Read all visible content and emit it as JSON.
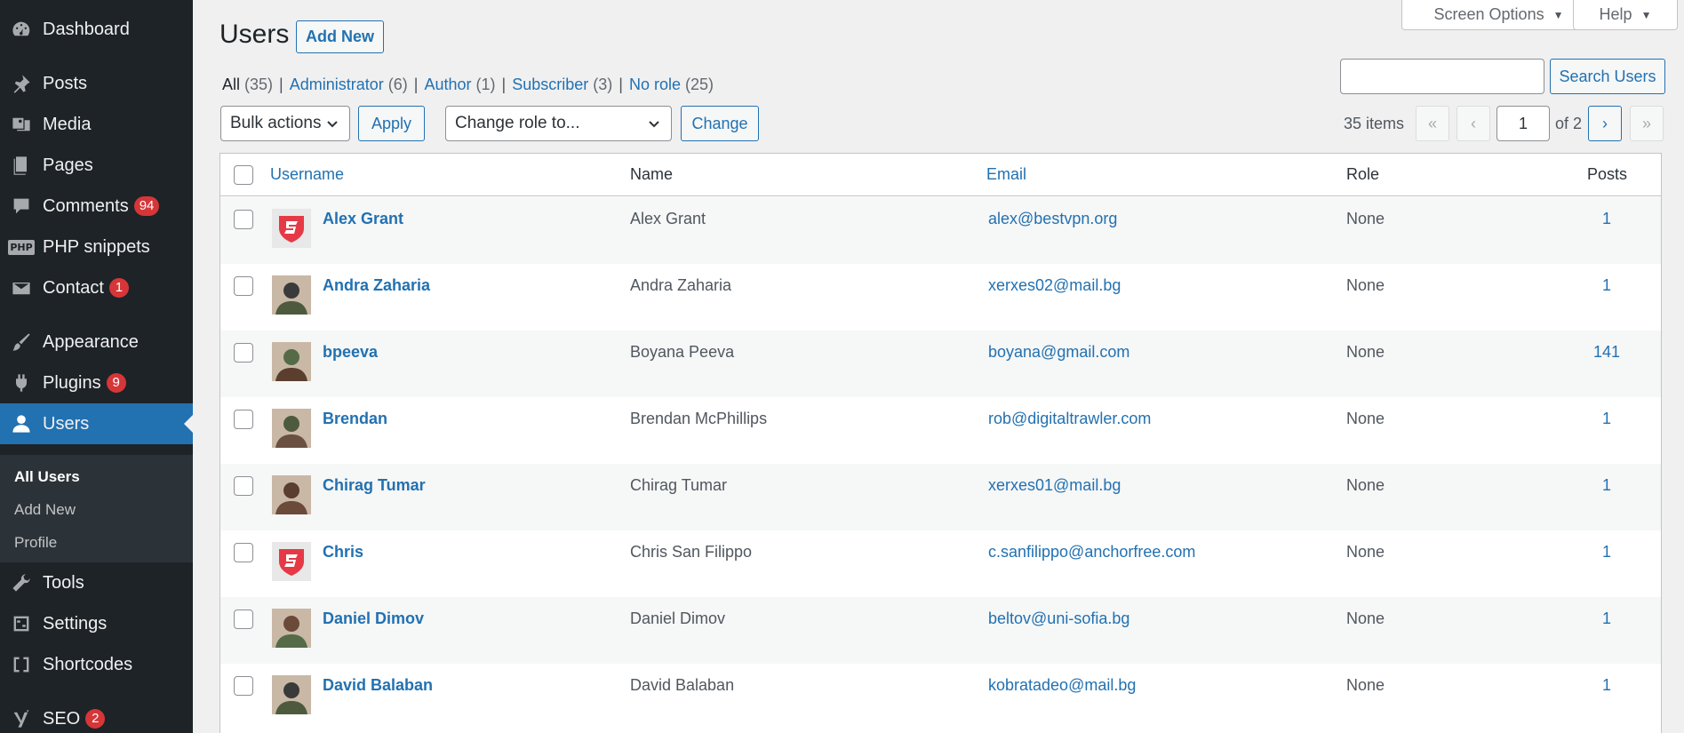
{
  "sidebar": {
    "items": [
      {
        "label": "Dashboard",
        "icon": "dashboard-icon"
      },
      {
        "label": "Posts",
        "icon": "pin-icon"
      },
      {
        "label": "Media",
        "icon": "media-icon"
      },
      {
        "label": "Pages",
        "icon": "pages-icon"
      },
      {
        "label": "Comments",
        "icon": "comment-icon",
        "badge": "94"
      },
      {
        "label": "PHP snippets",
        "icon": "php-icon",
        "icon_text": "PHP"
      },
      {
        "label": "Contact",
        "icon": "envelope-icon",
        "badge": "1"
      },
      {
        "label": "Appearance",
        "icon": "brush-icon"
      },
      {
        "label": "Plugins",
        "icon": "plug-icon",
        "badge": "9"
      },
      {
        "label": "Users",
        "icon": "user-icon",
        "active": true
      },
      {
        "label": "Tools",
        "icon": "wrench-icon"
      },
      {
        "label": "Settings",
        "icon": "settings-icon"
      },
      {
        "label": "Shortcodes",
        "icon": "brackets-icon"
      },
      {
        "label": "SEO",
        "icon": "yoast-icon",
        "badge": "2"
      }
    ],
    "submenu": [
      {
        "label": "All Users",
        "current": true
      },
      {
        "label": "Add New"
      },
      {
        "label": "Profile"
      }
    ]
  },
  "header": {
    "title": "Users",
    "add_new": "Add New",
    "screen_options": "Screen Options",
    "help": "Help"
  },
  "filters": {
    "all": {
      "label": "All",
      "count": "(35)"
    },
    "administrator": {
      "label": "Administrator",
      "count": "(6)"
    },
    "author": {
      "label": "Author",
      "count": "(1)"
    },
    "subscriber": {
      "label": "Subscriber",
      "count": "(3)"
    },
    "no_role": {
      "label": "No role",
      "count": "(25)"
    }
  },
  "search": {
    "value": "",
    "button": "Search Users"
  },
  "actions": {
    "bulk": "Bulk actions",
    "apply": "Apply",
    "role": "Change role to...",
    "change": "Change"
  },
  "pagination": {
    "items": "35 items",
    "first": "«",
    "prev": "‹",
    "current_page": "1",
    "of": "of 2",
    "next": "›",
    "last": "»"
  },
  "table": {
    "headers": {
      "username": "Username",
      "name": "Name",
      "email": "Email",
      "role": "Role",
      "posts": "Posts"
    },
    "rows": [
      {
        "username": "Alex Grant",
        "name": "Alex Grant",
        "email": "alex@bestvpn.org",
        "role": "None",
        "posts": "1",
        "avatar": "shield-logo"
      },
      {
        "username": "Andra Zaharia",
        "name": "Andra Zaharia",
        "email": "xerxes02@mail.bg",
        "role": "None",
        "posts": "1",
        "avatar": "photo"
      },
      {
        "username": "bpeeva",
        "name": "Boyana Peeva",
        "email": "boyana@gmail.com",
        "role": "None",
        "posts": "141",
        "avatar": "photo"
      },
      {
        "username": "Brendan",
        "name": "Brendan McPhillips",
        "email": "rob@digitaltrawler.com",
        "role": "None",
        "posts": "1",
        "avatar": "photo"
      },
      {
        "username": "Chirag Tumar",
        "name": "Chirag Tumar",
        "email": "xerxes01@mail.bg",
        "role": "None",
        "posts": "1",
        "avatar": "photo"
      },
      {
        "username": "Chris",
        "name": "Chris San Filippo",
        "email": "c.sanfilippo@anchorfree.com",
        "role": "None",
        "posts": "1",
        "avatar": "shield-logo"
      },
      {
        "username": "Daniel Dimov",
        "name": "Daniel Dimov",
        "email": "beltov@uni-sofia.bg",
        "role": "None",
        "posts": "1",
        "avatar": "photo"
      },
      {
        "username": "David Balaban",
        "name": "David Balaban",
        "email": "kobratadeo@mail.bg",
        "role": "None",
        "posts": "1",
        "avatar": "photo"
      }
    ]
  },
  "colors": {
    "accent": "#2271b1",
    "sidebar": "#1d2327",
    "badge": "#d63638"
  }
}
